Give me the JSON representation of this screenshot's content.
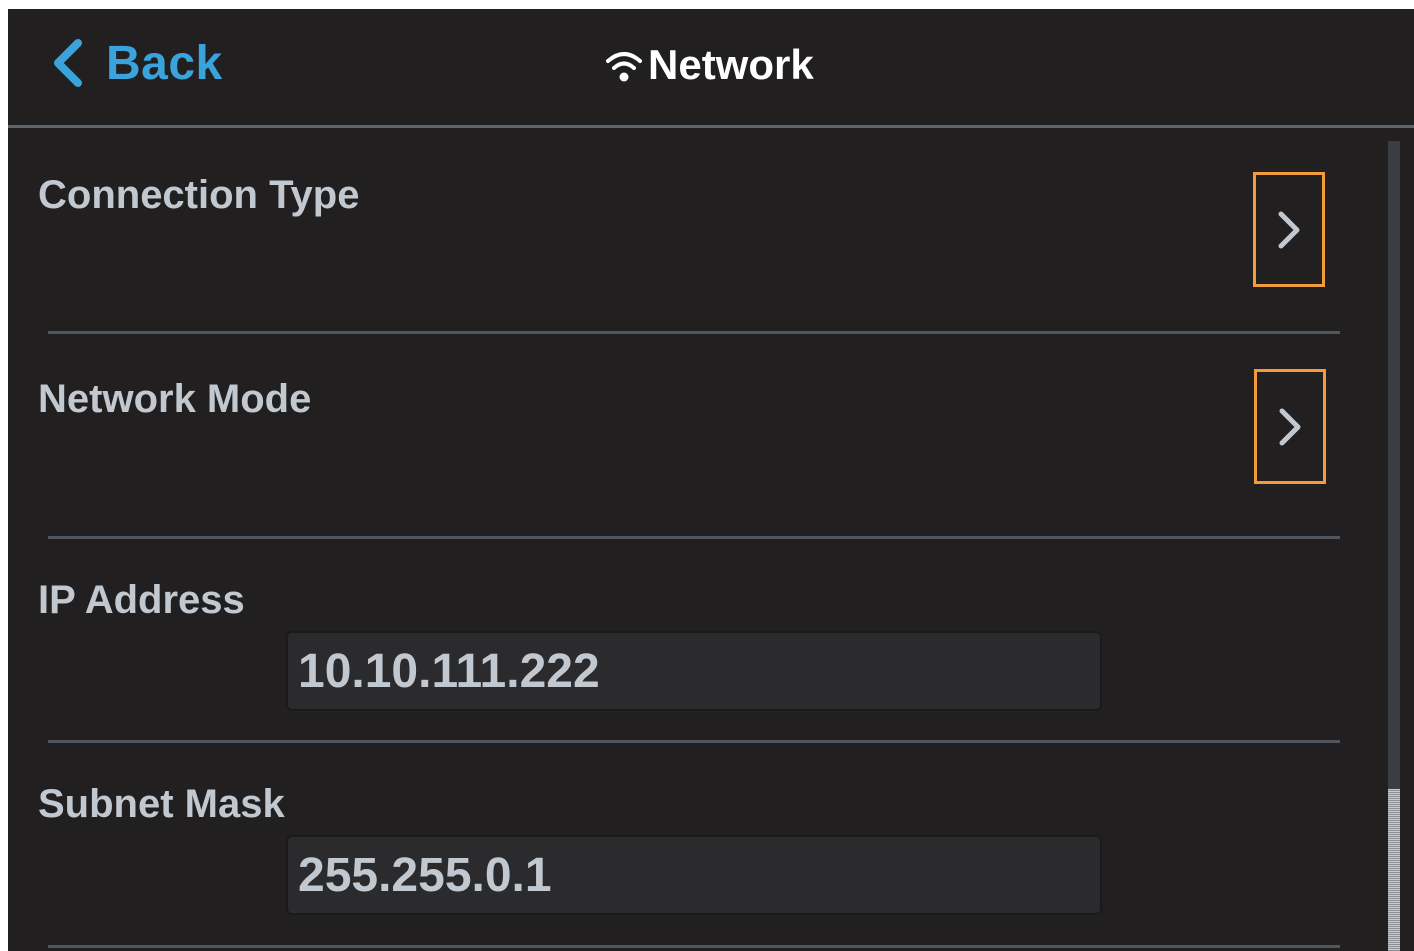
{
  "header": {
    "back_label": "Back",
    "back_icon": "chevron-left-icon",
    "title": "Network",
    "title_icon": "wifi-icon",
    "accent_color": "#3aa3dc"
  },
  "rows": {
    "connection_type": {
      "label": "Connection Type",
      "action_icon": "chevron-right-icon"
    },
    "network_mode": {
      "label": "Network Mode",
      "action_icon": "chevron-right-icon"
    },
    "ip_address": {
      "label": "IP Address",
      "value": "10.10.111.222"
    },
    "subnet_mask": {
      "label": "Subnet Mask",
      "value": "255.255.0.1"
    }
  },
  "colors": {
    "background": "#211f20",
    "highlight_border": "#f39a3a",
    "label_text": "#c2c8cf"
  }
}
